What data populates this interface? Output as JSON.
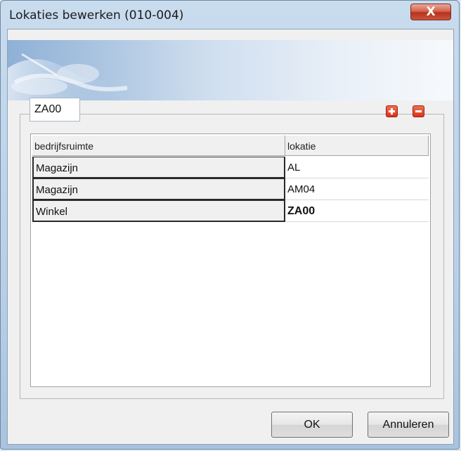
{
  "window": {
    "title": "Lokaties bewerken (010-004)",
    "close_label": "X"
  },
  "toolbar": {
    "location_value": "ZA00",
    "add_icon": "plus-icon",
    "remove_icon": "minus-icon"
  },
  "grid": {
    "columns": [
      "bedrijfsruimte",
      "lokatie"
    ],
    "rows": [
      [
        "Magazijn",
        "AL"
      ],
      [
        "Magazijn",
        "AM04"
      ],
      [
        "Winkel",
        "ZA00"
      ]
    ]
  },
  "buttons": {
    "ok_label": "OK",
    "cancel_label": "Annuleren"
  },
  "colors": {
    "accent_red": "#d8341a",
    "banner_blue": "#a7c2df"
  }
}
